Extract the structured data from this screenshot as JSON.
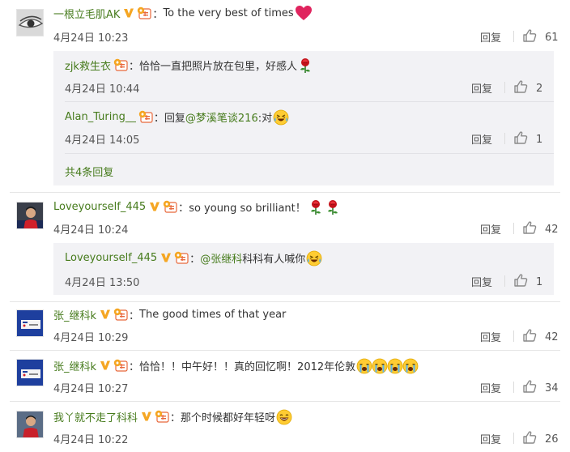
{
  "colors": {
    "accent_green": "#467b1c",
    "text": "#333333",
    "muted": "#555555",
    "subbox_bg": "#f2f2f5"
  },
  "comments": [
    {
      "user": "一根立毛肌AK",
      "text": "To the very best of times",
      "emoji": [
        "heart-icon"
      ],
      "date": "4月24日 10:23",
      "reply_label": "回复",
      "likes": "61",
      "replies": [
        {
          "user": "zjk救生衣",
          "text": "恰恰一直把照片放在包里，好感人",
          "emoji": [
            "rose-icon"
          ],
          "date": "4月24日 10:44",
          "reply_label": "回复",
          "likes": "2"
        },
        {
          "user": "Alan_Turing__",
          "prefix": "回复",
          "mention": "@梦溪笔谈216",
          "text": ":对",
          "emoji": [
            "laugh-tears-icon"
          ],
          "date": "4月24日 14:05",
          "reply_label": "回复",
          "likes": "1"
        }
      ],
      "more_label": "共4条回复"
    },
    {
      "user": "Loveyourself_445",
      "text": "so young so brilliant！",
      "emoji": [
        "rose-icon",
        "rose-icon"
      ],
      "date": "4月24日 10:24",
      "reply_label": "回复",
      "likes": "42",
      "replies": [
        {
          "user": "Loveyourself_445",
          "mention": "@张继科",
          "text": " 科科有人喊你",
          "emoji": [
            "laugh-tears-icon"
          ],
          "date": "4月24日 13:50",
          "reply_label": "回复",
          "likes": "1"
        }
      ]
    },
    {
      "user": "张_继科k",
      "text": "The good times of that year",
      "emoji": [],
      "date": "4月24日 10:29",
      "reply_label": "回复",
      "likes": "42"
    },
    {
      "user": "张_继科k",
      "text": "恰恰！！中午好！！真的回忆啊！2012年伦敦",
      "emoji": [
        "sob-icon",
        "sob-icon",
        "sob-icon",
        "sob-icon"
      ],
      "date": "4月24日 10:27",
      "reply_label": "回复",
      "likes": "34"
    },
    {
      "user": "我丫就不走了科科",
      "text": "那个时候都好年轻呀",
      "emoji": [
        "grin-icon"
      ],
      "date": "4月24日 10:22",
      "reply_label": "回复",
      "likes": "26"
    }
  ]
}
